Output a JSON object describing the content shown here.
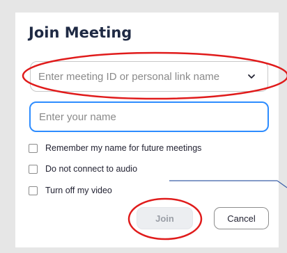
{
  "dialog": {
    "title": "Join Meeting",
    "meeting_id": {
      "placeholder": "Enter meeting ID or personal link name",
      "icon": "chevron-down-icon"
    },
    "name_field": {
      "placeholder": "Enter your name",
      "value": ""
    },
    "options": [
      {
        "label": "Remember my name for future meetings",
        "checked": false
      },
      {
        "label": "Do not connect to audio",
        "checked": false
      },
      {
        "label": "Turn off my video",
        "checked": false
      }
    ],
    "buttons": {
      "join": "Join",
      "cancel": "Cancel"
    }
  },
  "colors": {
    "accent": "#2d8cff",
    "annotation": "#e01b1b",
    "pointer_line": "#3a5fa8",
    "title": "#1f2a44",
    "background": "#e6e6e6"
  }
}
